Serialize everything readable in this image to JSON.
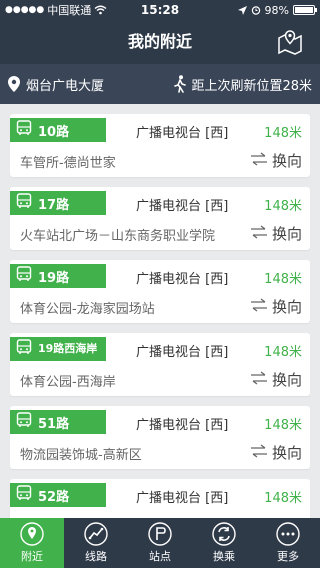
{
  "status": {
    "carrier": "中国联通",
    "time": "15:28",
    "battery": "98%",
    "battery_level": 0.98
  },
  "nav": {
    "title": "我的附近"
  },
  "location": {
    "place": "烟台广电大厦",
    "refresh_text": "距上次刷新位置28米"
  },
  "buses": [
    {
      "route": "10路",
      "stop": "广播电视台 [西]",
      "distance": "148米",
      "path": "车管所-德尚世家",
      "switch_label": "换向"
    },
    {
      "route": "17路",
      "stop": "广播电视台 [西]",
      "distance": "148米",
      "path": "火车站北广场－山东商务职业学院",
      "switch_label": "换向"
    },
    {
      "route": "19路",
      "stop": "广播电视台 [西]",
      "distance": "148米",
      "path": "体育公园-龙海家园场站",
      "switch_label": "换向"
    },
    {
      "route": "19路西海岸",
      "stop": "广播电视台 [西]",
      "distance": "148米",
      "path": "体育公园-西海岸",
      "switch_label": "换向"
    },
    {
      "route": "51路",
      "stop": "广播电视台 [西]",
      "distance": "148米",
      "path": "物流园装饰城-高新区",
      "switch_label": "换向"
    },
    {
      "route": "52路",
      "stop": "广播电视台 [西]",
      "distance": "148米",
      "path": "",
      "switch_label": ""
    }
  ],
  "tabs": [
    {
      "label": "附近"
    },
    {
      "label": "线路"
    },
    {
      "label": "站点"
    },
    {
      "label": "换乘"
    },
    {
      "label": "更多"
    }
  ],
  "colors": {
    "accent": "#41b24b",
    "dark": "#2f3a49"
  }
}
